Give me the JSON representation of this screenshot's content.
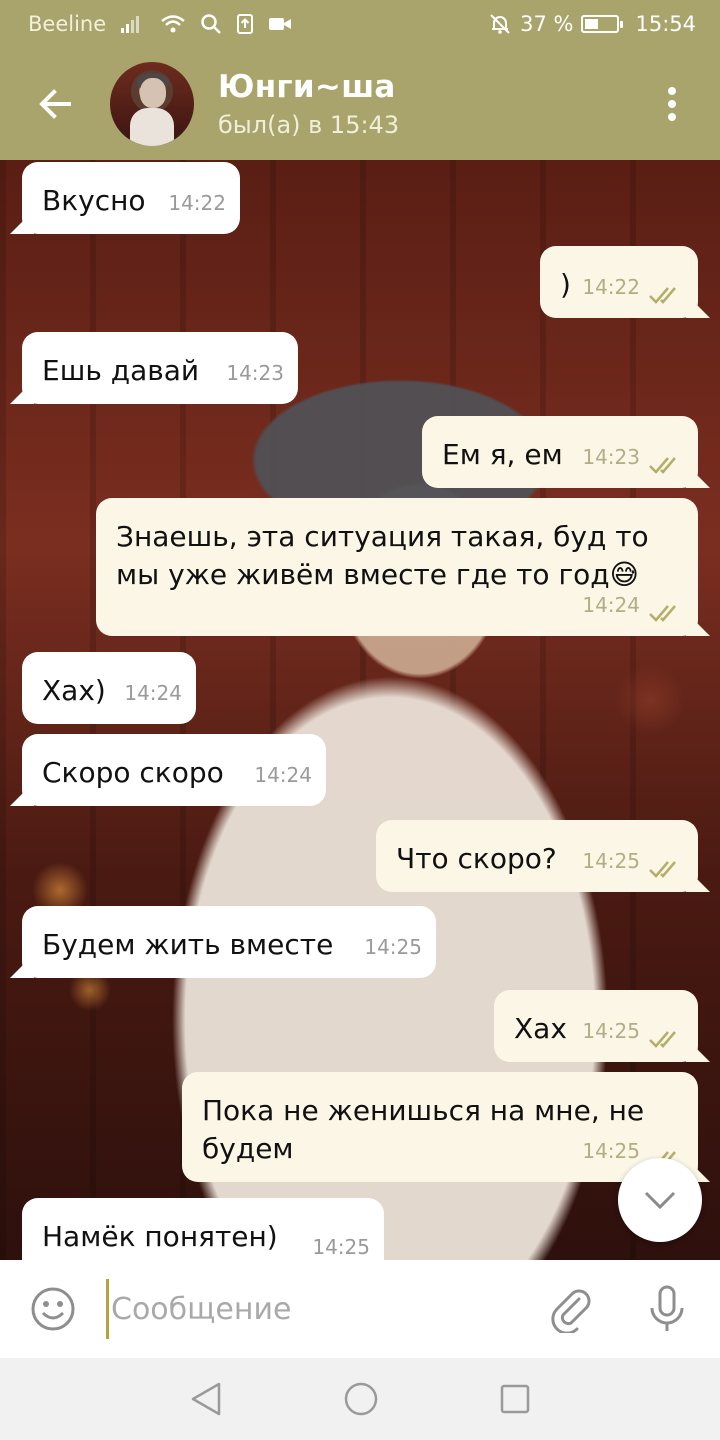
{
  "status_bar": {
    "carrier": "Beeline",
    "battery_percent": "37 %",
    "battery_level": 0.37,
    "time": "15:54"
  },
  "header": {
    "contact_name": "Юнги~ша",
    "last_seen": "был(а) в 15:43"
  },
  "messages": [
    {
      "direction": "in",
      "text": "Вкусно",
      "time": "14:22"
    },
    {
      "direction": "out",
      "text": ")",
      "time": "14:22",
      "read": true
    },
    {
      "direction": "in",
      "text": "Ешь давай",
      "time": "14:23"
    },
    {
      "direction": "out",
      "text": "Ем я, ем",
      "time": "14:23",
      "read": true
    },
    {
      "direction": "out",
      "text": "Знаешь, эта ситуация такая, буд то мы уже живём вместе где то год😅",
      "time": "14:24",
      "read": true
    },
    {
      "direction": "in",
      "text": "Хах)",
      "time": "14:24"
    },
    {
      "direction": "in",
      "text": "Скоро скоро",
      "time": "14:24"
    },
    {
      "direction": "out",
      "text": "Что скоро?",
      "time": "14:25",
      "read": true
    },
    {
      "direction": "in",
      "text": "Будем жить вместе",
      "time": "14:25"
    },
    {
      "direction": "out",
      "text": "Хах",
      "time": "14:25",
      "read": true
    },
    {
      "direction": "out",
      "text": "Пока не женишься на мне, не будем",
      "time": "14:25",
      "read": true
    },
    {
      "direction": "in",
      "text": "Намёк понятен)",
      "time": "14:25"
    }
  ],
  "composer": {
    "placeholder": "Сообщение"
  },
  "icons": {
    "back": "arrow-left-icon",
    "menu": "more-vertical-icon",
    "emoji": "smiley-icon",
    "attach": "paperclip-icon",
    "mic": "microphone-icon",
    "scroll_down": "chevron-down-icon",
    "nav_back": "triangle-back-icon",
    "nav_home": "circle-home-icon",
    "nav_recents": "square-recents-icon"
  },
  "colors": {
    "header": "#a8a46c",
    "incoming_bubble": "#ffffff",
    "outgoing_bubble": "#fbf6e6",
    "read_ticks": "#b5ad6a"
  }
}
